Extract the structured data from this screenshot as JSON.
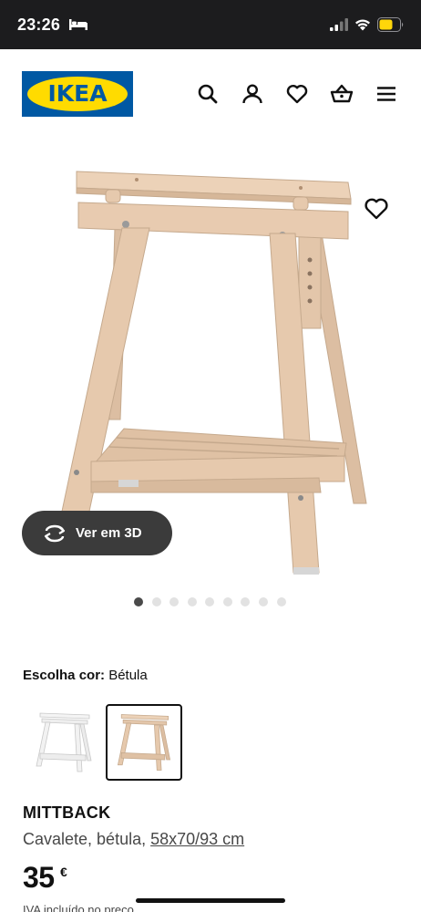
{
  "status_bar": {
    "time": "23:26"
  },
  "header": {
    "logo_text": "IKEA",
    "icons": [
      "search-icon",
      "account-icon",
      "heart-icon",
      "basket-icon",
      "menu-icon"
    ]
  },
  "gallery": {
    "view3d_label": "Ver em 3D",
    "image_count": 9,
    "active_index": 0
  },
  "color": {
    "label": "Escolha cor:",
    "value": "Bétula",
    "variants": [
      "Branco",
      "Bétula"
    ],
    "selected_variant": 1
  },
  "product": {
    "name": "MITTBACK",
    "desc_prefix": "Cavalete, bétula, ",
    "size": "58x70/93 cm",
    "price": "35",
    "currency": "€",
    "vat_note": "IVA incluído no preço"
  },
  "colors": {
    "brand_blue": "#0058a3",
    "brand_yellow": "#ffdb00",
    "wood": "#e3c6aa"
  }
}
